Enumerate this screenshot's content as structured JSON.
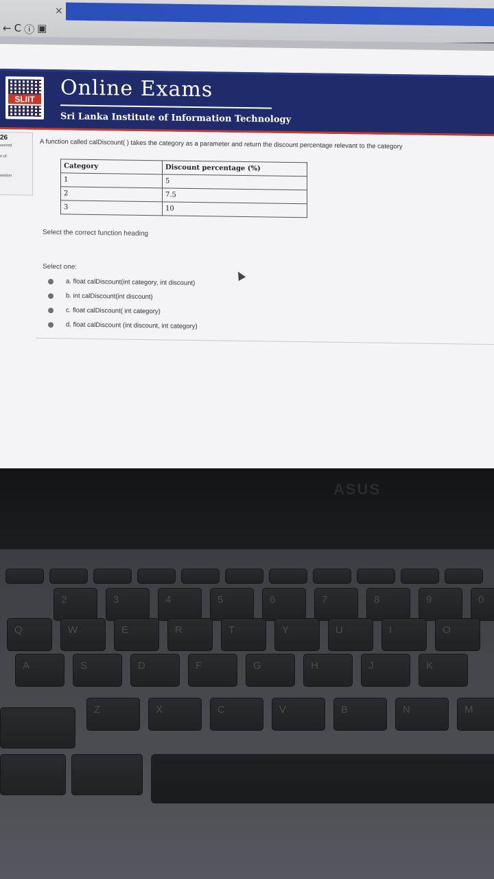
{
  "browser": {
    "close_glyph": "×",
    "nav_back": "←",
    "nav_reload": "C",
    "nav_info": "ⓘ",
    "nav_page": "▣"
  },
  "header": {
    "logo_text": "SLIIT",
    "title": "Online Exams",
    "subtitle": "Sri Lanka Institute of Information Technology"
  },
  "question": {
    "text": "A function called calDiscount( ) takes the category as a parameter and return the discount percentage relevant to the category",
    "table": {
      "headers": [
        "Category",
        "Discount percentage (%)"
      ],
      "rows": [
        [
          "1",
          "5"
        ],
        [
          "2",
          "7.5"
        ],
        [
          "3",
          "10"
        ]
      ]
    },
    "prompt": "Select the correct function heading",
    "select_label": "Select one:",
    "options": [
      "a. float calDiscount(int category, int discount)",
      "b. int calDiscount(int discount)",
      "c. float calDiscount( int category)",
      "d. float calDiscount (int discount, int category)"
    ]
  },
  "laptop": {
    "brand": "ASUS",
    "keys_row1": [
      "2",
      "3",
      "4",
      "5",
      "6",
      "7",
      "8",
      "9",
      "0"
    ],
    "keys_row2": [
      "Q",
      "W",
      "E",
      "R",
      "T",
      "Y",
      "U",
      "I",
      "O"
    ],
    "keys_row3": [
      "A",
      "S",
      "D",
      "F",
      "G",
      "H",
      "J",
      "K"
    ],
    "keys_row4": [
      "Z",
      "X",
      "C",
      "V",
      "B",
      "N",
      "M"
    ]
  },
  "colors": {
    "banner": "#1f2b6b",
    "accent_rule": "#c8382b",
    "tab_strip": "#2c52c4",
    "page_bg": "#f4f4f6"
  }
}
